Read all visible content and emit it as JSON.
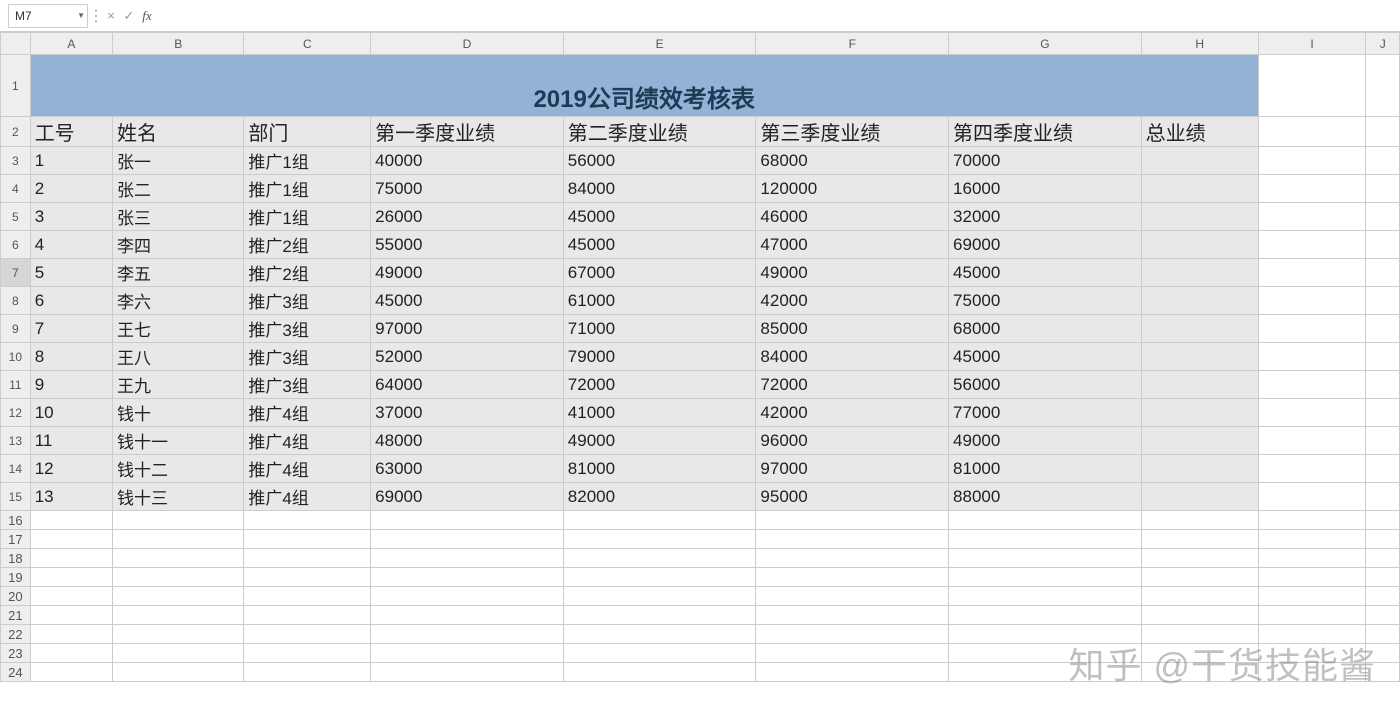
{
  "nameBox": "M7",
  "formula": "",
  "cancelGlyph": "×",
  "enterGlyph": "✓",
  "fxGlyph": "fx",
  "columns": [
    "A",
    "B",
    "C",
    "D",
    "E",
    "F",
    "G",
    "H",
    "I",
    "J"
  ],
  "rowLabels": [
    "1",
    "2",
    "3",
    "4",
    "5",
    "6",
    "7",
    "8",
    "9",
    "10",
    "11",
    "12",
    "13",
    "14",
    "15",
    "16",
    "17",
    "18",
    "19",
    "20",
    "21",
    "22",
    "23",
    "24"
  ],
  "title": "2019公司绩效考核表",
  "headers": [
    "工号",
    "姓名",
    "部门",
    "第一季度业绩",
    "第二季度业绩",
    "第三季度业绩",
    "第四季度业绩",
    "总业绩"
  ],
  "rows": [
    [
      "1",
      "张一",
      "推广1组",
      "40000",
      "56000",
      "68000",
      "70000",
      ""
    ],
    [
      "2",
      "张二",
      "推广1组",
      "75000",
      "84000",
      "120000",
      "16000",
      ""
    ],
    [
      "3",
      "张三",
      "推广1组",
      "26000",
      "45000",
      "46000",
      "32000",
      ""
    ],
    [
      "4",
      "李四",
      "推广2组",
      "55000",
      "45000",
      "47000",
      "69000",
      ""
    ],
    [
      "5",
      "李五",
      "推广2组",
      "49000",
      "67000",
      "49000",
      "45000",
      ""
    ],
    [
      "6",
      "李六",
      "推广3组",
      "45000",
      "61000",
      "42000",
      "75000",
      ""
    ],
    [
      "7",
      "王七",
      "推广3组",
      "97000",
      "71000",
      "85000",
      "68000",
      ""
    ],
    [
      "8",
      "王八",
      "推广3组",
      "52000",
      "79000",
      "84000",
      "45000",
      ""
    ],
    [
      "9",
      "王九",
      "推广3组",
      "64000",
      "72000",
      "72000",
      "56000",
      ""
    ],
    [
      "10",
      "钱十",
      "推广4组",
      "37000",
      "41000",
      "42000",
      "77000",
      ""
    ],
    [
      "11",
      "钱十一",
      "推广4组",
      "48000",
      "49000",
      "96000",
      "49000",
      ""
    ],
    [
      "12",
      "钱十二",
      "推广4组",
      "63000",
      "81000",
      "97000",
      "81000",
      ""
    ],
    [
      "13",
      "钱十三",
      "推广4组",
      "69000",
      "82000",
      "95000",
      "88000",
      ""
    ]
  ],
  "watermark": "知乎 @干货技能酱"
}
